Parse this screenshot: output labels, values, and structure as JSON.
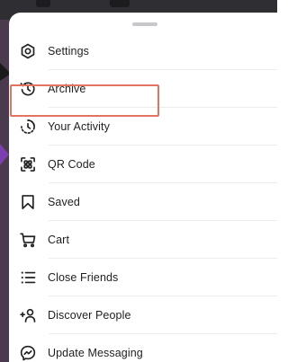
{
  "menu": {
    "items": [
      {
        "label": "Settings",
        "icon": "settings-gear-icon"
      },
      {
        "label": "Archive",
        "icon": "archive-clock-icon"
      },
      {
        "label": "Your Activity",
        "icon": "activity-icon"
      },
      {
        "label": "QR Code",
        "icon": "qr-code-icon"
      },
      {
        "label": "Saved",
        "icon": "bookmark-icon"
      },
      {
        "label": "Cart",
        "icon": "cart-icon"
      },
      {
        "label": "Close Friends",
        "icon": "list-icon"
      },
      {
        "label": "Discover People",
        "icon": "add-person-icon"
      },
      {
        "label": "Update Messaging",
        "icon": "messenger-icon"
      }
    ]
  },
  "highlight": {
    "target": "Archive",
    "color": "#e2735f"
  },
  "colors": {
    "sheet": "#ffffff",
    "text": "#1f1f1f",
    "icon": "#222222",
    "divider": "#ececec"
  }
}
